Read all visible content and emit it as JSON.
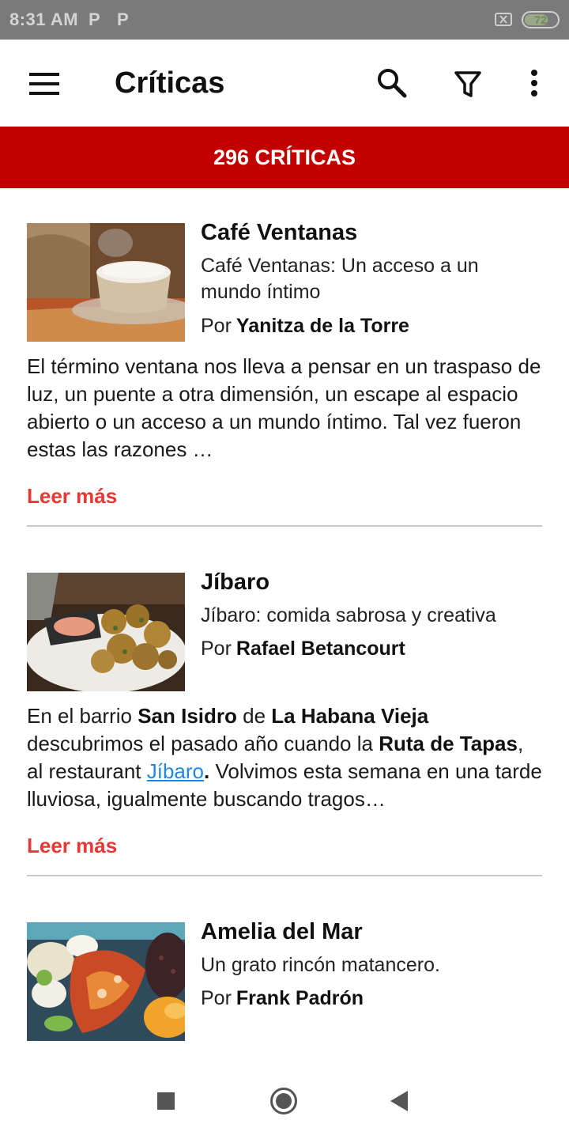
{
  "status_bar": {
    "time": "8:31 AM",
    "notification_icons": [
      "P",
      "P"
    ],
    "battery_level": "72"
  },
  "app_bar": {
    "title": "Críticas",
    "icons": [
      "menu-icon",
      "search-icon",
      "filter-icon",
      "more-vert-icon"
    ]
  },
  "banner": {
    "count_label": "296 CRÍTICAS",
    "color": "#c30000"
  },
  "reviews": [
    {
      "title": "Café Ventanas",
      "subtitle": "Café Ventanas: Un acceso a un mundo íntimo",
      "author_prefix": "Por",
      "author": "Yanitza de la Torre",
      "excerpt": "El término ventana nos lleva a pensar en un traspaso de luz, un puente a otra dimensión, un escape al espacio abierto o un acceso a un mundo íntimo. Tal vez fueron estas las razones …",
      "read_more": "Leer más",
      "image": "coffee-cup-image"
    },
    {
      "title": "Jíbaro",
      "subtitle": "Jíbaro: comida sabrosa y creativa",
      "author_prefix": "Por",
      "author": "Rafael Betancourt",
      "excerpt_parts": {
        "p1": "En el barrio ",
        "b1": "San Isidro",
        "p2": " de ",
        "b2": "La Habana Vieja",
        "p3": " descubrimos el pasado año cuando la ",
        "b3": "Ruta de Tapas",
        "p4": ", al restaurant ",
        "link": "Jíbaro",
        "b4": ".",
        "p5": " Volvimos esta semana en una tarde lluviosa, igualmente buscando tragos…"
      },
      "read_more": "Leer más",
      "image": "fritters-plate-image"
    },
    {
      "title": "Amelia del Mar",
      "subtitle": "Un grato rincón matancero.",
      "author_prefix": "Por",
      "author": "Frank Padrón",
      "image": "seafood-dish-image"
    }
  ],
  "colors": {
    "accent_red": "#c30000",
    "read_more_red": "#e53935",
    "link_blue": "#1e88e5"
  }
}
